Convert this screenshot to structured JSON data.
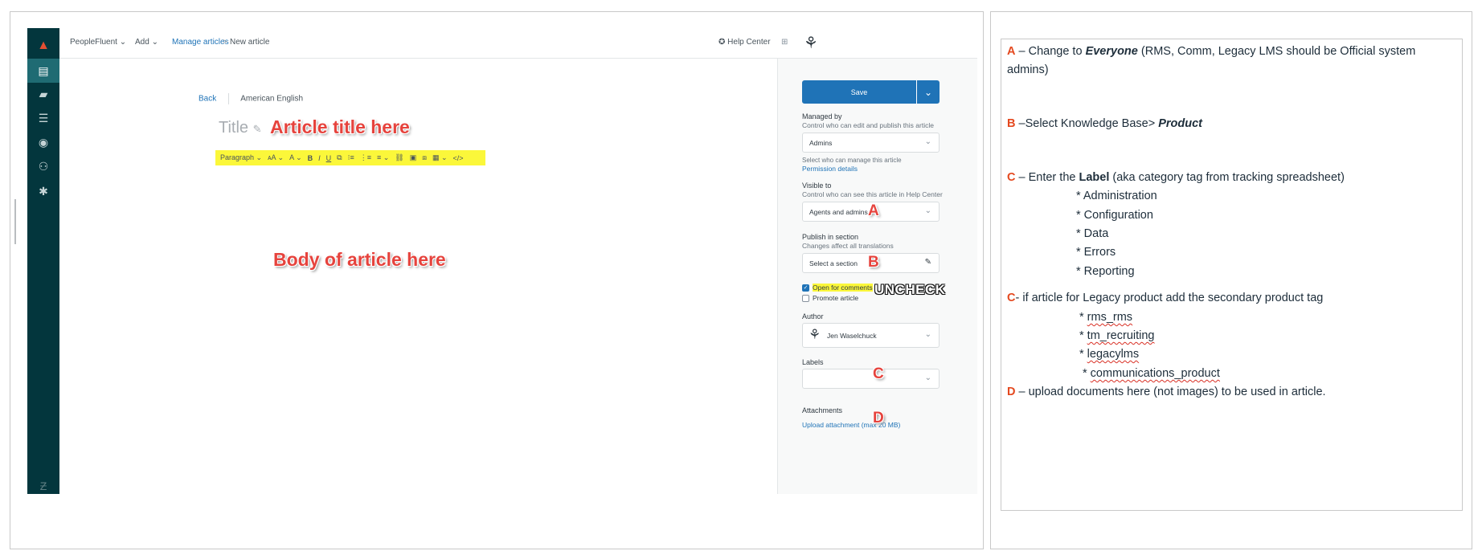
{
  "screenshot": {
    "topbar": {
      "brand_menu": "PeopleFluent",
      "add_menu": "Add",
      "breadcrumb_link": "Manage articles",
      "breadcrumb_sep": ">",
      "breadcrumb_current": "New article",
      "help_center": "Help Center"
    },
    "rail_icons": [
      "zendesk-logo-icon",
      "guide-book-icon",
      "alert-icon",
      "list-icon",
      "eye-icon",
      "users-icon",
      "gear-icon",
      "zendesk-z-icon"
    ],
    "editor": {
      "back": "Back",
      "language": "American English",
      "title_placeholder": "Title",
      "toolbar": [
        "Paragraph ⌄",
        "ᴀA ⌄",
        "A ⌄",
        "B",
        "I",
        "U",
        "⧉",
        "⁝≡",
        "⋮≡",
        "≡ ⌄",
        "⛓",
        "▣",
        "⧈",
        "▦ ⌄",
        "</>"
      ]
    },
    "annotations": {
      "title": "Article title here",
      "body": "Body of article here",
      "A": "A",
      "B": "B",
      "C": "C",
      "D": "D",
      "uncheck": "UNCHECK"
    },
    "sidebar": {
      "save_label": "Save",
      "managed_by_label": "Managed by",
      "managed_by_hint": "Control who can edit and publish this article",
      "managed_by_value": "Admins",
      "managed_by_note": "Select who can manage this article",
      "permission_details": "Permission details",
      "visible_to_label": "Visible to",
      "visible_to_hint": "Control who can see this article in Help Center",
      "visible_to_value": "Agents and admins",
      "publish_label": "Publish in section",
      "publish_hint": "Changes affect all translations",
      "publish_value": "Select a section",
      "open_comments": "Open for comments",
      "promote": "Promote article",
      "author_label": "Author",
      "author_value": "Jen Waselchuck",
      "labels_label": "Labels",
      "labels_value": "",
      "attachments_label": "Attachments",
      "upload_link": "Upload attachment (max 20 MB)"
    }
  },
  "notes": {
    "a_letter": "A",
    "a_text_1": " – Change to ",
    "a_bold": "Everyone",
    "a_text_2": " (RMS, Comm, Legacy LMS should be Official system admins)",
    "b_letter": "B",
    "b_text": " –Select Knowledge Base> ",
    "b_bold": "Product",
    "c_letter": "C",
    "c_text_1": " – Enter the ",
    "c_bold": "Label",
    "c_text_2": " (aka category tag from tracking spreadsheet)",
    "c_items": [
      "* Administration",
      "* Configuration",
      "* Data",
      "* Errors",
      "* Reporting"
    ],
    "c2_letter": "C",
    "c2_text": "- if article for Legacy product add the secondary product tag",
    "c2_items": [
      "rms_rms",
      "tm_recruiting",
      "legacylms",
      "communications_product"
    ],
    "d_letter": "D",
    "d_text": " – upload documents here (not images) to be used in article."
  }
}
